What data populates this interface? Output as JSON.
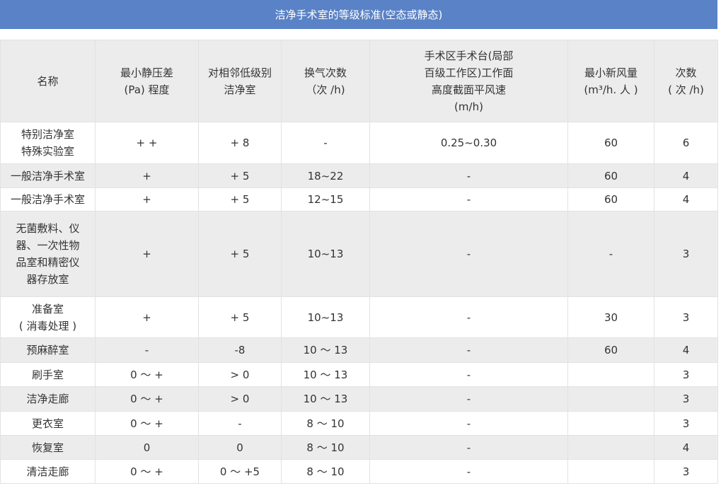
{
  "title": "洁净手术室的等级标准(空态或静态)",
  "table": {
    "headers": [
      [
        "名称"
      ],
      [
        "最小静压差",
        "(Pa) 程度"
      ],
      [
        "对相邻低级别",
        "洁净室"
      ],
      [
        "换气次数",
        "（次 /h)"
      ],
      [
        "手术区手术台(局部",
        "百级工作区)工作面",
        "高度截面平风速",
        "(m/h)"
      ],
      [
        "最小新风量",
        "(m³/h. 人 )"
      ],
      [
        "次数",
        "( 次 /h)"
      ]
    ],
    "rows": [
      [
        [
          "特别洁净室",
          "特殊实验室"
        ],
        [
          "+ +"
        ],
        [
          "+ 8"
        ],
        [
          "-"
        ],
        [
          "0.25~0.30"
        ],
        [
          "60"
        ],
        [
          "6"
        ]
      ],
      [
        [
          "一般洁净手术室"
        ],
        [
          "+"
        ],
        [
          "+ 5"
        ],
        [
          "18~22"
        ],
        [
          "-"
        ],
        [
          "60"
        ],
        [
          "4"
        ]
      ],
      [
        [
          "一般洁净手术室"
        ],
        [
          "+"
        ],
        [
          "+ 5"
        ],
        [
          "12~15"
        ],
        [
          "-"
        ],
        [
          "60"
        ],
        [
          "4"
        ]
      ],
      [
        [
          "无菌敷料、仪",
          "器、一次性物",
          "品室和精密仪",
          "器存放室"
        ],
        [
          "+"
        ],
        [
          "+ 5"
        ],
        [
          "10~13"
        ],
        [
          "-"
        ],
        [
          "-"
        ],
        [
          "3"
        ]
      ],
      [
        [
          "准备室",
          "( 消毒处理 )"
        ],
        [
          "+"
        ],
        [
          "+ 5"
        ],
        [
          "10~13"
        ],
        [
          "-"
        ],
        [
          "30"
        ],
        [
          "3"
        ]
      ],
      [
        [
          "预麻醉室"
        ],
        [
          "-"
        ],
        [
          "-8"
        ],
        [
          "10 ～ 13"
        ],
        [
          "-"
        ],
        [
          "60"
        ],
        [
          "4"
        ]
      ],
      [
        [
          "刷手室"
        ],
        [
          "0 ～ +"
        ],
        [
          "> 0"
        ],
        [
          "10 ～ 13"
        ],
        [
          "-"
        ],
        [
          ""
        ],
        [
          "3"
        ]
      ],
      [
        [
          "洁净走廊"
        ],
        [
          "0 ～ +"
        ],
        [
          "> 0"
        ],
        [
          "10 ～ 13"
        ],
        [
          "-"
        ],
        [
          ""
        ],
        [
          "3"
        ]
      ],
      [
        [
          "更衣室"
        ],
        [
          "0 ～ +"
        ],
        [
          "-"
        ],
        [
          "8 ～ 10"
        ],
        [
          "-"
        ],
        [
          ""
        ],
        [
          "3"
        ]
      ],
      [
        [
          "恢复室"
        ],
        [
          "0"
        ],
        [
          "0"
        ],
        [
          "8 ～ 10"
        ],
        [
          "-"
        ],
        [
          ""
        ],
        [
          "4"
        ]
      ],
      [
        [
          "清洁走廊"
        ],
        [
          "0 ～ +"
        ],
        [
          "0 ～ +5"
        ],
        [
          "8 ～ 10"
        ],
        [
          "-"
        ],
        [
          ""
        ],
        [
          "3"
        ]
      ]
    ]
  }
}
